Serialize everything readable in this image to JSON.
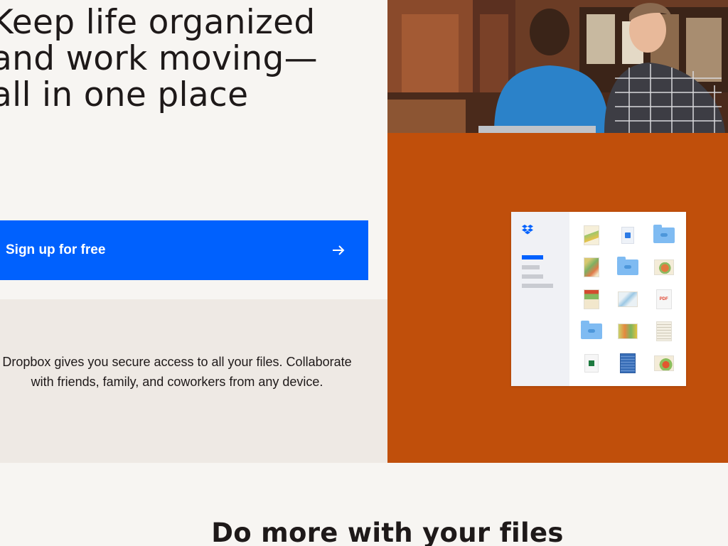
{
  "hero": {
    "headline": "Keep life organized\nand work moving—\nall in one place",
    "cta_label": "Sign up for free",
    "cta_icon": "arrow-right-icon",
    "description": "Dropbox gives you secure access to all your files. Collaborate with friends, family, and coworkers from any device."
  },
  "colors": {
    "page_bg": "#f7f5f2",
    "cta_blue": "#0061fe",
    "info_bg": "#eee9e4",
    "orange_panel": "#c04f0b",
    "text": "#1e1919"
  },
  "app_preview": {
    "logo_icon": "dropbox-logo-icon",
    "files": [
      {
        "kind": "image-thumbnail"
      },
      {
        "kind": "document"
      },
      {
        "kind": "folder"
      },
      {
        "kind": "image-thumbnail"
      },
      {
        "kind": "folder"
      },
      {
        "kind": "image-thumbnail"
      },
      {
        "kind": "image-thumbnail"
      },
      {
        "kind": "image-thumbnail"
      },
      {
        "kind": "pdf",
        "label": "PDF"
      },
      {
        "kind": "folder"
      },
      {
        "kind": "image-thumbnail"
      },
      {
        "kind": "document"
      },
      {
        "kind": "spreadsheet"
      },
      {
        "kind": "document"
      },
      {
        "kind": "image-thumbnail"
      }
    ]
  },
  "section": {
    "title": "Do more with your files"
  }
}
